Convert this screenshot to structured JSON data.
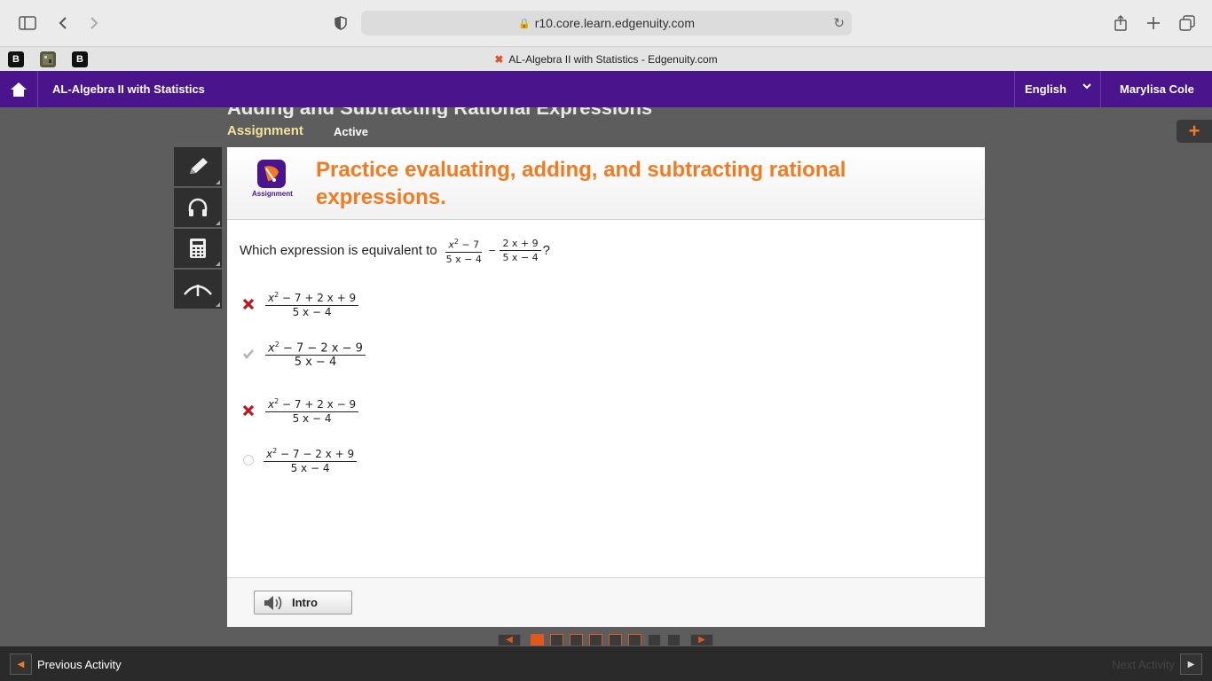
{
  "browser": {
    "url": "r10.core.learn.edgenuity.com",
    "tab_title": "AL-Algebra II with Statistics - Edgenuity.com",
    "bookmarks": [
      "B",
      "",
      "B"
    ]
  },
  "header": {
    "course_title": "AL-Algebra II with Statistics",
    "language": "English",
    "user_name": "Marylisa Cole"
  },
  "lesson": {
    "title": "Adding and Subtracting Rational Expressions",
    "type_label": "Assignment",
    "status": "Active"
  },
  "activity": {
    "badge_label": "Assignment",
    "heading": "Practice evaluating, adding, and subtracting rational expressions.",
    "question_text": "Which expression is equivalent to",
    "question_end": "?",
    "expr1": {
      "num_base": "x",
      "num_exp": "2",
      "num_rest": "− 7",
      "den": "5 x − 4"
    },
    "operator": "−",
    "expr2": {
      "num": "2 x + 9",
      "den": "5 x − 4"
    },
    "options": [
      {
        "num_base": "x",
        "num_exp": "2",
        "num_rest": "− 7 + 2 x + 9",
        "den": "5 x − 4",
        "state": "incorrect"
      },
      {
        "num_base": "x",
        "num_exp": "2",
        "num_rest": "− 7 − 2 x − 9",
        "den": "5 x − 4",
        "state": "correct-dimmed"
      },
      {
        "num_base": "x",
        "num_exp": "2",
        "num_rest": "− 7 + 2 x − 9",
        "den": "5 x − 4",
        "state": "incorrect"
      },
      {
        "num_base": "x",
        "num_exp": "2",
        "num_rest": "− 7 − 2 x + 9",
        "den": "5 x − 4",
        "state": "unselected"
      }
    ],
    "intro_button": "Intro"
  },
  "navigation": {
    "previous": "Previous Activity",
    "next": "Next Activity",
    "pages_total": 8,
    "pages_done": 6,
    "current_page": 1
  },
  "colors": {
    "header_purple": "#4a148c",
    "accent_orange": "#f47a20",
    "incorrect_red": "#c0161e"
  }
}
